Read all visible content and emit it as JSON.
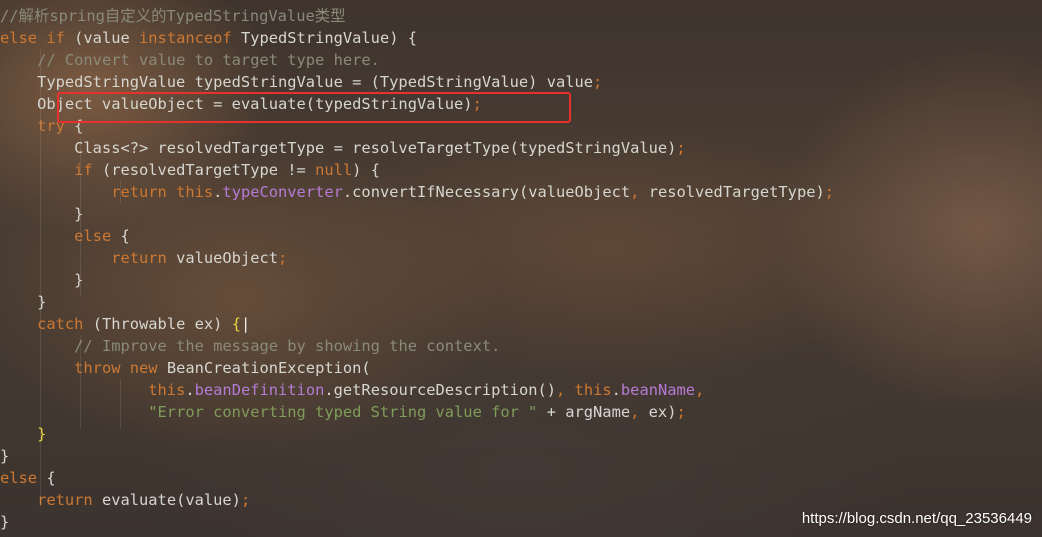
{
  "code": {
    "lines": [
      {
        "tokens": [
          {
            "t": "comment",
            "v": "//解析spring自定义的TypedStringValue类型"
          }
        ]
      },
      {
        "tokens": [
          {
            "t": "keyword",
            "v": "else if"
          },
          {
            "t": "plain",
            "v": " (value "
          },
          {
            "t": "keyword",
            "v": "instanceof"
          },
          {
            "t": "plain",
            "v": " TypedStringValue) {"
          }
        ]
      },
      {
        "tokens": [
          {
            "t": "plain",
            "v": "    "
          },
          {
            "t": "comment",
            "v": "// Convert value to target type here."
          }
        ]
      },
      {
        "tokens": [
          {
            "t": "plain",
            "v": "    TypedStringValue typedStringValue = (TypedStringValue) value"
          },
          {
            "t": "keyword",
            "v": ";"
          }
        ]
      },
      {
        "tokens": [
          {
            "t": "plain",
            "v": "    Object valueObject = evaluate(typedStringValue)"
          },
          {
            "t": "keyword",
            "v": ";"
          }
        ]
      },
      {
        "tokens": [
          {
            "t": "plain",
            "v": "    "
          },
          {
            "t": "keyword",
            "v": "try"
          },
          {
            "t": "plain",
            "v": " {"
          }
        ]
      },
      {
        "tokens": [
          {
            "t": "plain",
            "v": "        Class<?> resolvedTargetType = resolveTargetType(typedStringValue)"
          },
          {
            "t": "keyword",
            "v": ";"
          }
        ]
      },
      {
        "tokens": [
          {
            "t": "plain",
            "v": "        "
          },
          {
            "t": "keyword",
            "v": "if"
          },
          {
            "t": "plain",
            "v": " (resolvedTargetType != "
          },
          {
            "t": "keyword",
            "v": "null"
          },
          {
            "t": "plain",
            "v": ") {"
          }
        ]
      },
      {
        "tokens": [
          {
            "t": "plain",
            "v": "            "
          },
          {
            "t": "keyword",
            "v": "return this"
          },
          {
            "t": "plain",
            "v": "."
          },
          {
            "t": "field",
            "v": "typeConverter"
          },
          {
            "t": "plain",
            "v": ".convertIfNecessary(valueObject"
          },
          {
            "t": "keyword",
            "v": ","
          },
          {
            "t": "plain",
            "v": " resolvedTargetType)"
          },
          {
            "t": "keyword",
            "v": ";"
          }
        ]
      },
      {
        "tokens": [
          {
            "t": "plain",
            "v": "        }"
          }
        ]
      },
      {
        "tokens": [
          {
            "t": "plain",
            "v": "        "
          },
          {
            "t": "keyword",
            "v": "else"
          },
          {
            "t": "plain",
            "v": " {"
          }
        ]
      },
      {
        "tokens": [
          {
            "t": "plain",
            "v": "            "
          },
          {
            "t": "keyword",
            "v": "return"
          },
          {
            "t": "plain",
            "v": " valueObject"
          },
          {
            "t": "keyword",
            "v": ";"
          }
        ]
      },
      {
        "tokens": [
          {
            "t": "plain",
            "v": "        }"
          }
        ]
      },
      {
        "tokens": [
          {
            "t": "plain",
            "v": "    }"
          }
        ]
      },
      {
        "tokens": [
          {
            "t": "plain",
            "v": "    "
          },
          {
            "t": "keyword",
            "v": "catch"
          },
          {
            "t": "plain",
            "v": " (Throwable ex) "
          },
          {
            "t": "brace-hl",
            "v": "{"
          },
          {
            "t": "cursor",
            "v": "|"
          }
        ]
      },
      {
        "tokens": [
          {
            "t": "plain",
            "v": "        "
          },
          {
            "t": "comment",
            "v": "// Improve the message by showing the context."
          }
        ]
      },
      {
        "tokens": [
          {
            "t": "plain",
            "v": "        "
          },
          {
            "t": "keyword",
            "v": "throw new"
          },
          {
            "t": "plain",
            "v": " BeanCreationException("
          }
        ]
      },
      {
        "tokens": [
          {
            "t": "plain",
            "v": "                "
          },
          {
            "t": "keyword",
            "v": "this"
          },
          {
            "t": "plain",
            "v": "."
          },
          {
            "t": "field",
            "v": "beanDefinition"
          },
          {
            "t": "plain",
            "v": ".getResourceDescription()"
          },
          {
            "t": "keyword",
            "v": ", this"
          },
          {
            "t": "plain",
            "v": "."
          },
          {
            "t": "field",
            "v": "beanName"
          },
          {
            "t": "keyword",
            "v": ","
          }
        ]
      },
      {
        "tokens": [
          {
            "t": "plain",
            "v": "                "
          },
          {
            "t": "string",
            "v": "\"Error converting typed String value for \""
          },
          {
            "t": "plain",
            "v": " + argName"
          },
          {
            "t": "keyword",
            "v": ","
          },
          {
            "t": "plain",
            "v": " ex)"
          },
          {
            "t": "keyword",
            "v": ";"
          }
        ]
      },
      {
        "tokens": [
          {
            "t": "plain",
            "v": "    "
          },
          {
            "t": "brace-hl",
            "v": "}"
          }
        ]
      },
      {
        "tokens": [
          {
            "t": "plain",
            "v": "}"
          }
        ]
      },
      {
        "tokens": [
          {
            "t": "keyword",
            "v": "else"
          },
          {
            "t": "plain",
            "v": " {"
          }
        ]
      },
      {
        "tokens": [
          {
            "t": "plain",
            "v": "    "
          },
          {
            "t": "keyword",
            "v": "return"
          },
          {
            "t": "plain",
            "v": " evaluate(value)"
          },
          {
            "t": "keyword",
            "v": ";"
          }
        ]
      },
      {
        "tokens": [
          {
            "t": "plain",
            "v": "}"
          }
        ]
      }
    ]
  },
  "watermark": "https://blog.csdn.net/qq_23536449",
  "colors": {
    "highlight_box": "#e8302c",
    "keyword": "#cc7832",
    "comment": "#8a8a7a",
    "string": "#7f9c5a",
    "field": "#b67bd5",
    "plain": "#d6d6d0"
  }
}
